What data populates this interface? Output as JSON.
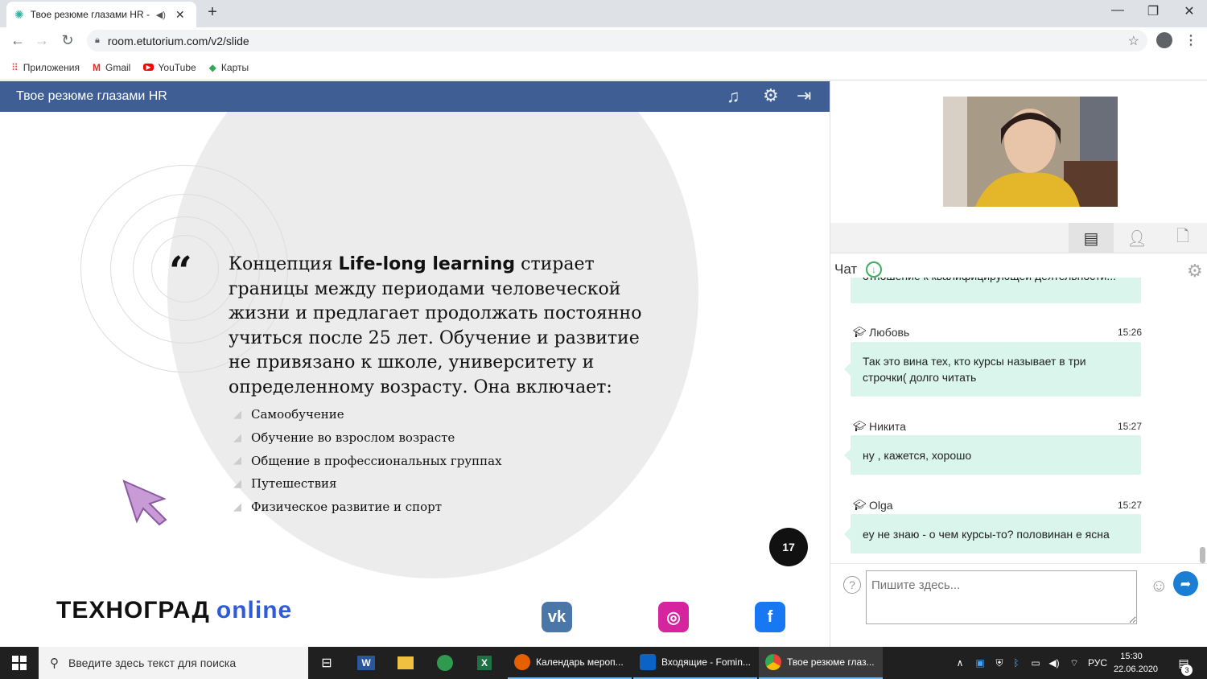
{
  "browser": {
    "tab_title": "Твое резюме глазами HR - ",
    "url": "room.etutorium.com/v2/slide",
    "bookmarks": [
      {
        "label": "Приложения",
        "icon": "apps-grid-icon"
      },
      {
        "label": "Gmail",
        "icon": "gmail-icon"
      },
      {
        "label": "YouTube",
        "icon": "youtube-icon"
      },
      {
        "label": "Карты",
        "icon": "maps-icon"
      }
    ]
  },
  "app": {
    "title": "Твое резюме глазами HR"
  },
  "slide": {
    "text_plain_1": "Концепция ",
    "text_bold": "Life-long learning",
    "text_plain_2": " стирает границы между периодами человеческой жизни и предлагает продолжать постоянно учиться после 25 лет. Обучение и развитие не привязано к школе, университету и определенному возрасту. Она включает:",
    "bullets": [
      "Самообучение",
      "Обучение во взрослом возрасте",
      "Общение в профессиональных группах",
      "Путешествия",
      "Физическое развитие и спорт"
    ],
    "page_number": "17",
    "logo_main": "ТЕХНОГРАД",
    "logo_online": "online"
  },
  "chat": {
    "header": "Чат",
    "partial_message": "отношение к квалифицирующей деятельности...",
    "messages": [
      {
        "name": "Любовь",
        "time": "15:26",
        "text": "Так это вина тех, кто курсы называет в три строчки( долго читать"
      },
      {
        "name": "Никита",
        "time": "15:27",
        "text": "ну , кажется, хорошо"
      },
      {
        "name": "Olga",
        "time": "15:27",
        "text": "еу не знаю - о чем курсы-то? половинан е ясна"
      }
    ],
    "input_placeholder": "Пишите здесь..."
  },
  "taskbar": {
    "search_placeholder": "Введите здесь текст для поиска",
    "apps": [
      {
        "label": "Календарь мероп...",
        "color": "#e66000"
      },
      {
        "label": "Входящие - Fomin...",
        "color": "#0a64c8"
      },
      {
        "label": "Твое резюме глаз...",
        "color": "#4caf50"
      }
    ],
    "language": "РУС",
    "time": "15:30",
    "date": "22.06.2020",
    "notifications": "3"
  }
}
